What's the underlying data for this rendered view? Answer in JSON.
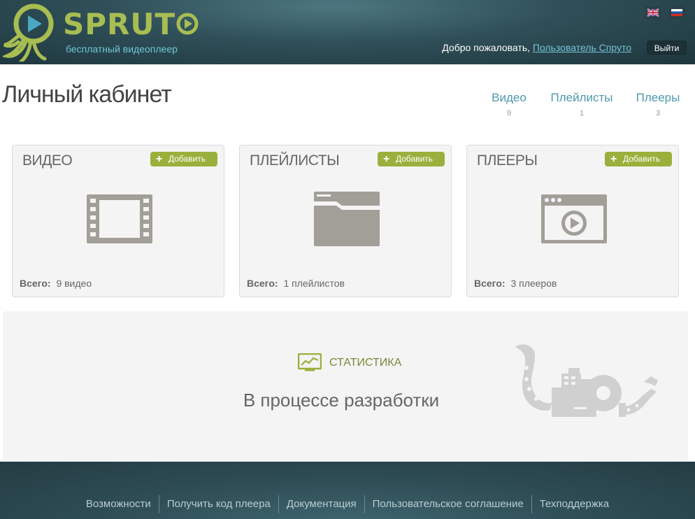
{
  "header": {
    "logo_text": "SPRUT",
    "tagline": "бесплатный видеоплеер",
    "welcome_prefix": "Добро пожаловать,",
    "user_link": "Пользователь Спруто",
    "logout_label": "Выйти",
    "languages": [
      "en-flag-icon",
      "ru-flag-icon"
    ]
  },
  "page": {
    "title": "Личный кабинет"
  },
  "summary": [
    {
      "label": "Видео",
      "count": "9"
    },
    {
      "label": "Плейлисты",
      "count": "1"
    },
    {
      "label": "Плееры",
      "count": "3"
    }
  ],
  "cards": [
    {
      "title": "Видео",
      "add_label": "Добавить",
      "total_label": "Всего:",
      "total_value": "9 видео",
      "icon": "film-icon"
    },
    {
      "title": "Плейлисты",
      "add_label": "Добавить",
      "total_label": "Всего:",
      "total_value": "1 плейлистов",
      "icon": "folder-icon"
    },
    {
      "title": "Плееры",
      "add_label": "Добавить",
      "total_label": "Всего:",
      "total_value": "3 плееров",
      "icon": "player-window-icon"
    }
  ],
  "statistics": {
    "title": "СТАТИСТИКА",
    "status": "В процессе разработки"
  },
  "footer": {
    "links": [
      "Возможности",
      "Получить код плеера",
      "Документация",
      "Пользовательское соглашение",
      "Техподдержка"
    ]
  },
  "colors": {
    "accent_green": "#9ab03c",
    "link_blue": "#4d99ad",
    "header_dark": "#2f4f58"
  }
}
